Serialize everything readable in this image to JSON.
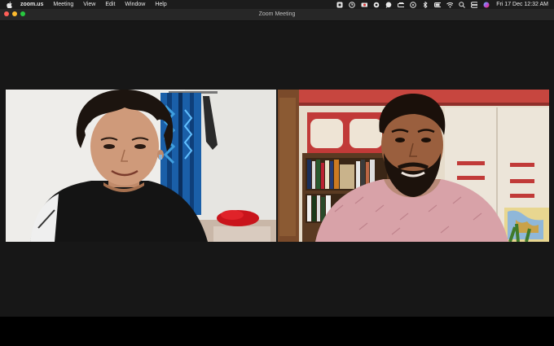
{
  "menubar": {
    "app_name": "zoom.us",
    "menus": [
      "Meeting",
      "View",
      "Edit",
      "Window",
      "Help"
    ],
    "status_icons": [
      "dropbox-icon",
      "timer-icon",
      "recording-icon",
      "at-icon",
      "chat-icon",
      "battery-car-icon",
      "play-icon",
      "bluetooth-icon",
      "battery-icon",
      "wifi-icon",
      "search-icon",
      "control-center-icon",
      "siri-icon"
    ],
    "clock": "Fri 17 Dec  12:32 AM"
  },
  "window": {
    "title": "Zoom Meeting",
    "traffic_lights": {
      "close": "#fe5f57",
      "minimize": "#febc2e",
      "maximize": "#28c840"
    }
  },
  "participants": [
    {
      "tile": "left",
      "description_icon": "participant-video-1"
    },
    {
      "tile": "right",
      "description_icon": "participant-video-2"
    }
  ]
}
